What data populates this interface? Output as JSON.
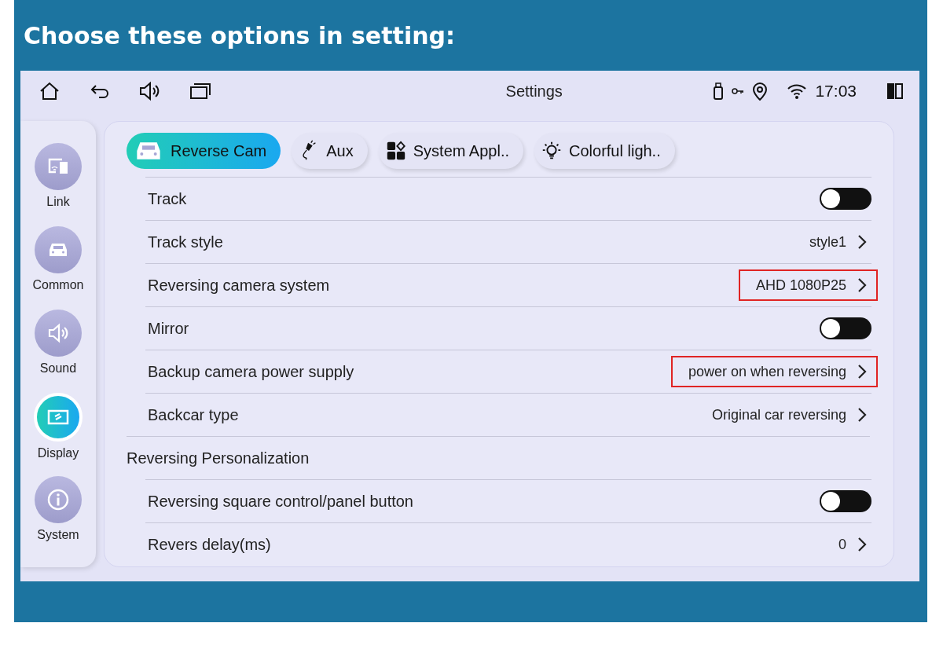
{
  "banner": {
    "title": "Choose these options in setting:"
  },
  "status_bar": {
    "title": "Settings",
    "time": "17:03"
  },
  "sidebar": {
    "items": [
      {
        "label": "Link",
        "selected": false
      },
      {
        "label": "Common",
        "selected": false
      },
      {
        "label": "Sound",
        "selected": false
      },
      {
        "label": "Display",
        "selected": true
      },
      {
        "label": "System",
        "selected": false
      }
    ]
  },
  "tabs": [
    {
      "label": "Reverse Cam",
      "selected": true
    },
    {
      "label": "Aux",
      "selected": false
    },
    {
      "label": "System Appl..",
      "selected": false
    },
    {
      "label": "Colorful ligh..",
      "selected": false
    }
  ],
  "rows": [
    {
      "kind": "toggle",
      "label": "Track",
      "on": false
    },
    {
      "kind": "value",
      "label": "Track style",
      "value": "style1",
      "highlighted": false
    },
    {
      "kind": "value",
      "label": "Reversing camera system",
      "value": "AHD 1080P25",
      "highlighted": true
    },
    {
      "kind": "toggle",
      "label": "Mirror",
      "on": false
    },
    {
      "kind": "value",
      "label": "Backup camera power supply",
      "value": "power on when reversing",
      "highlighted": true
    },
    {
      "kind": "value",
      "label": "Backcar type",
      "value": "Original car reversing",
      "highlighted": false
    },
    {
      "kind": "section",
      "label": "Reversing Personalization"
    },
    {
      "kind": "toggle",
      "label": "Reversing square control/panel button",
      "on": false
    },
    {
      "kind": "value",
      "label": "Revers delay(ms)",
      "value": "0",
      "highlighted": false
    }
  ]
}
